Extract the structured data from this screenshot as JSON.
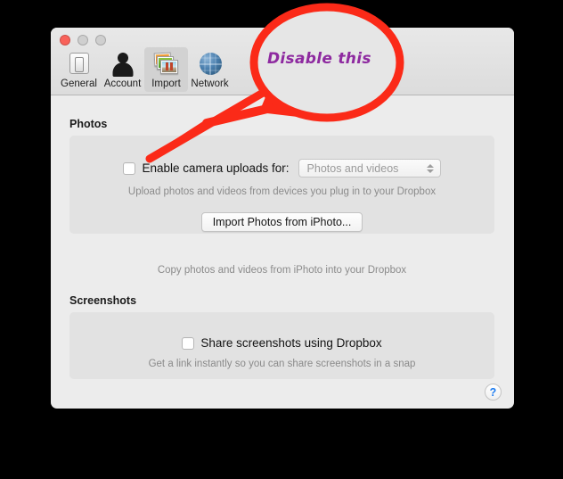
{
  "window": {
    "traffic_lights": [
      "close",
      "minimize",
      "zoom"
    ],
    "toolbar": {
      "items": [
        {
          "label": "General",
          "icon": "toggle-switch-icon",
          "selected": false
        },
        {
          "label": "Account",
          "icon": "person-silhouette-icon",
          "selected": false
        },
        {
          "label": "Import",
          "icon": "photo-stack-icon",
          "selected": true
        },
        {
          "label": "Network",
          "icon": "globe-icon",
          "selected": false
        }
      ]
    }
  },
  "photos_section": {
    "title": "Photos",
    "camera_uploads": {
      "checkbox_label": "Enable camera uploads for:",
      "checked": false,
      "dropdown_value": "Photos and videos",
      "dropdown_enabled": false
    },
    "camera_uploads_hint": "Upload photos and videos from devices you plug in to your Dropbox",
    "import_button_label": "Import Photos from iPhoto...",
    "import_hint": "Copy photos and videos from iPhoto into your Dropbox"
  },
  "screenshots_section": {
    "title": "Screenshots",
    "share_checkbox_label": "Share screenshots using Dropbox",
    "share_checked": false,
    "share_hint": "Get a link instantly so you can share screenshots in a snap"
  },
  "help": {
    "label": "?"
  },
  "annotation": {
    "callout_text": "Disable this",
    "callout_text_color": "#8e2aa0",
    "stroke_color": "#fb2a18",
    "bubble_fill": "#e6e6e6"
  }
}
